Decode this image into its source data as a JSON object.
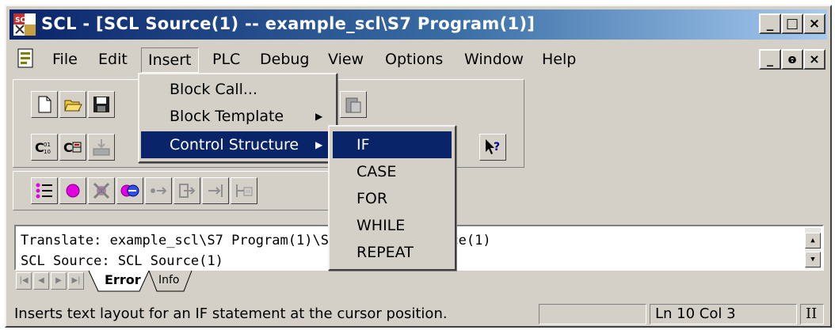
{
  "window": {
    "title": "SCL  - [SCL Source(1) -- example_scl\\S7 Program(1)]",
    "app_icon": "scl-app-icon"
  },
  "caption_buttons": {
    "minimize": "_",
    "maximize": "□",
    "close": "×"
  },
  "mdi_buttons": {
    "minimize": "_",
    "restore": "ⱺ",
    "close": "×"
  },
  "menubar": {
    "items": [
      {
        "label": "File"
      },
      {
        "label": "Edit"
      },
      {
        "label": "Insert",
        "open": true
      },
      {
        "label": "PLC"
      },
      {
        "label": "Debug"
      },
      {
        "label": "View"
      },
      {
        "label": "Options"
      },
      {
        "label": "Window"
      },
      {
        "label": "Help"
      }
    ]
  },
  "insert_menu": {
    "items": [
      {
        "label": "Block Call...",
        "submenu": false
      },
      {
        "label": "Block Template",
        "submenu": true
      },
      {
        "label": "Control Structure",
        "submenu": true,
        "highlighted": true
      }
    ]
  },
  "control_structure_submenu": {
    "items": [
      {
        "label": "IF",
        "highlighted": true
      },
      {
        "label": "CASE"
      },
      {
        "label": "FOR"
      },
      {
        "label": "WHILE"
      },
      {
        "label": "REPEAT"
      }
    ]
  },
  "toolbar": {
    "row1": [
      "new-file-icon",
      "open-folder-icon",
      "save-icon",
      "paste-icon"
    ],
    "row2": [
      {
        "icon": "compile-icon",
        "glyph": "C⁰¹₁₀"
      },
      {
        "icon": "compile-all-icon",
        "glyph": "C⊞"
      },
      {
        "icon": "download-icon",
        "glyph": ""
      },
      {
        "icon": "context-help-icon",
        "glyph": "?"
      }
    ],
    "row3": [
      "breakpoint-list-icon",
      "set-breakpoint-icon",
      "delete-breakpoints-icon",
      "toggle-breakpoints-icon",
      "go-to-next-icon",
      "step-into-icon",
      "step-over-icon",
      "run-to-cursor-icon"
    ]
  },
  "output": {
    "lines": [
      "Translate: example_scl\\S7 Program(1)\\Sources\\SCL Source(1)",
      "SCL Source: SCL Source(1)"
    ],
    "tabs": [
      {
        "label": "Error",
        "active": true
      },
      {
        "label": "Info",
        "active": false
      }
    ]
  },
  "statusbar": {
    "message": "Inserts text layout for an IF statement at the cursor position.",
    "position": "Ln 10 Col 3",
    "mode": "II"
  },
  "colors": {
    "face": "#d4d0c8",
    "title_start": "#0a246a",
    "title_end": "#a6caf0",
    "highlight": "#0a246a"
  }
}
